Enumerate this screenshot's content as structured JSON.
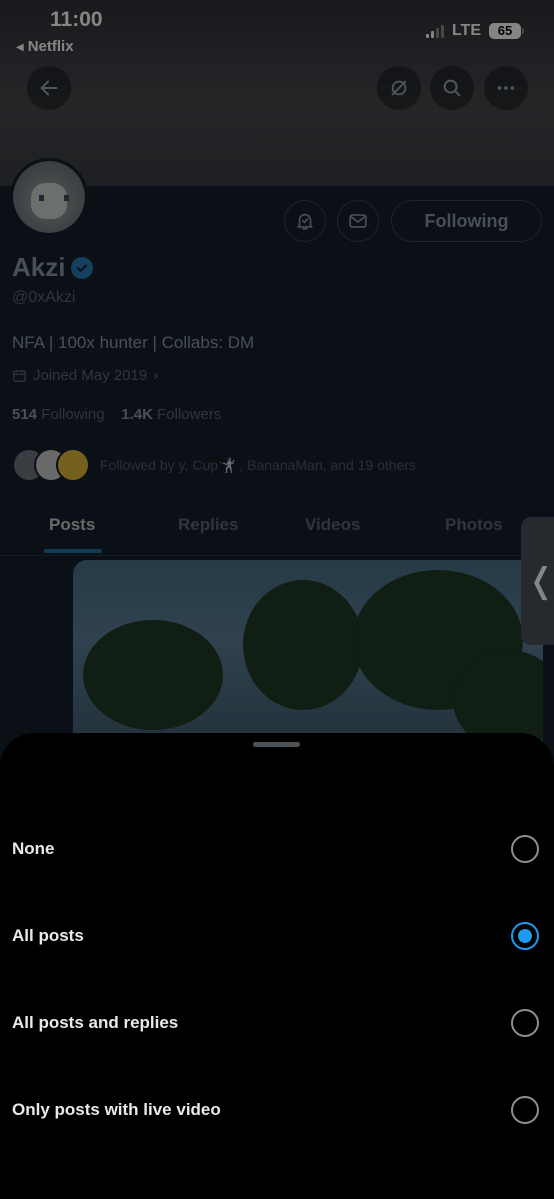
{
  "status_bar": {
    "time": "11:00",
    "back_app": "Netflix",
    "network": "LTE",
    "battery": "65"
  },
  "header": {
    "icons": [
      "arrow-left-icon",
      "hide-icon",
      "search-icon",
      "more-icon"
    ]
  },
  "profile": {
    "name": "Akzi",
    "handle": "@0xAkzi",
    "bio": "NFA | 100x hunter | Collabs: DM",
    "joined": "Joined May 2019",
    "following_count": "514",
    "following_label": "Following",
    "followers_count": "1.4K",
    "followers_label": "Followers",
    "followed_by": "Followed by y, Cup🤺 , BananaMan, and 19 others",
    "following_button": "Following"
  },
  "tabs": [
    {
      "label": "Posts",
      "active": true
    },
    {
      "label": "Replies",
      "active": false
    },
    {
      "label": "Videos",
      "active": false
    },
    {
      "label": "Photos",
      "active": false
    }
  ],
  "sheet": {
    "options": [
      {
        "label": "None",
        "selected": false
      },
      {
        "label": "All posts",
        "selected": true
      },
      {
        "label": "All posts and replies",
        "selected": false
      },
      {
        "label": "Only posts with live video",
        "selected": false
      }
    ]
  },
  "colors": {
    "accent": "#1d9bf0",
    "background": "#15202b",
    "sheet": "#000000"
  }
}
